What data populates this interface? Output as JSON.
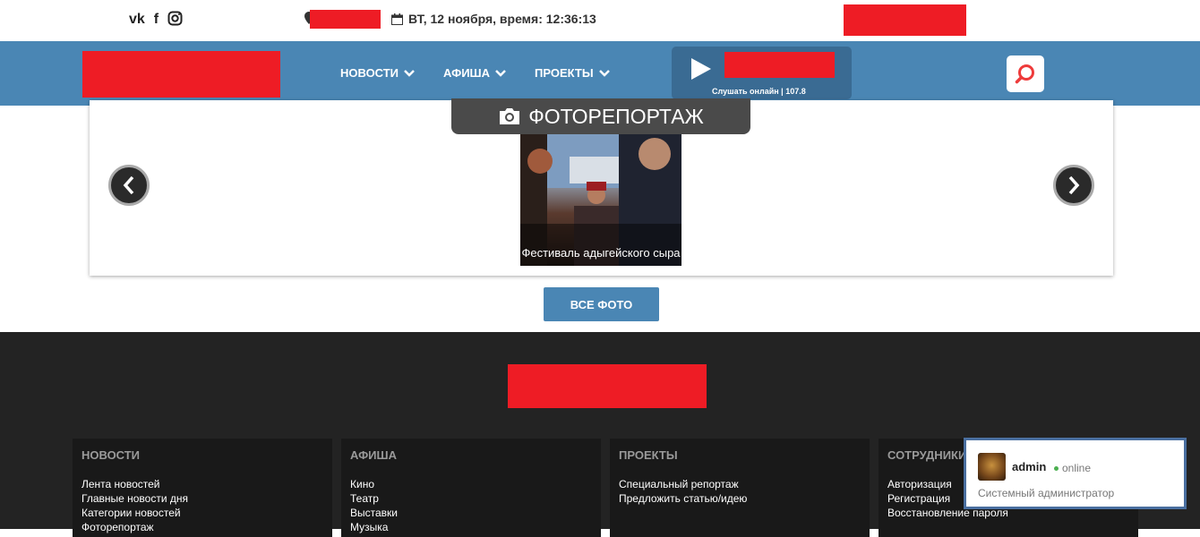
{
  "topbar": {
    "social": [
      "vk-icon",
      "facebook-icon",
      "instagram-icon"
    ],
    "date_text": "ВТ, 12 ноября, время: 12:36:13"
  },
  "nav": {
    "items": [
      {
        "label": "НОВОСТИ"
      },
      {
        "label": "АФИША"
      },
      {
        "label": "ПРОЕКТЫ"
      }
    ]
  },
  "radio": {
    "caption": "Слушать онлайн | 107.8"
  },
  "gallery": {
    "title": "ФОТОРЕПОРТАЖ",
    "photo_caption": "Фестиваль адыгейского сыра",
    "all_button": "ВСЕ ФОТО"
  },
  "footer": {
    "columns": [
      {
        "title": "НОВОСТИ",
        "links": [
          "Лента новостей",
          "Главные новости дня",
          "Категории новостей",
          "Фоторепортаж"
        ]
      },
      {
        "title": "АФИША",
        "links": [
          "Кино",
          "Театр",
          "Выставки",
          "Музыка"
        ]
      },
      {
        "title": "ПРОЕКТЫ",
        "links": [
          "Специальный репортаж",
          "Предложить статью/идею"
        ]
      },
      {
        "title": "СОТРУДНИКИ",
        "links": [
          "Авторизация",
          "Регистрация",
          "Восстановление пароля"
        ]
      }
    ]
  },
  "admin_popup": {
    "name": "admin",
    "status": "online",
    "role": "Системный администратор"
  },
  "colors": {
    "brand_blue": "#4a86b4",
    "redaction": "#ee1c25",
    "footer_bg": "#232323"
  }
}
